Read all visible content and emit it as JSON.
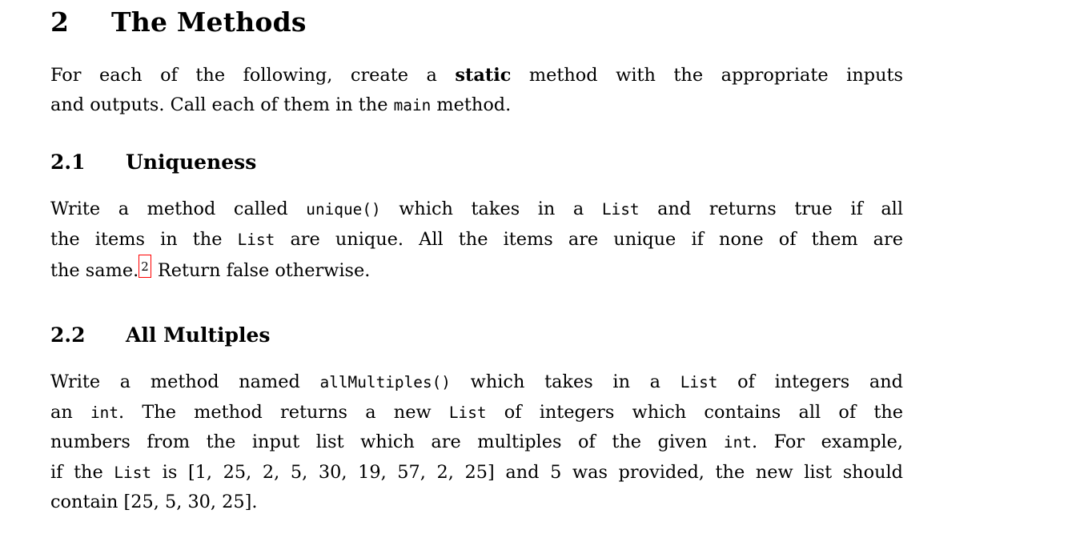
{
  "document": {
    "section": {
      "number": "2",
      "title": "The Methods",
      "intro": {
        "line1_a": "For each of the following, create a ",
        "line1_bold": "static",
        "line1_b": " method with the appropriate inputs",
        "line2_a": "and outputs.  Call each of them in the ",
        "line2_code": "main",
        "line2_b": " method."
      },
      "subsections": [
        {
          "number": "2.1",
          "title": "Uniqueness",
          "body": {
            "line1_a": "Write a method called ",
            "line1_code1": "unique()",
            "line1_b": " which takes in a ",
            "line1_code2": "List",
            "line1_c": " and returns true if all",
            "line2_a": "the items in the ",
            "line2_code": "List",
            "line2_b": " are unique.  All the items are unique if none of them are",
            "line3_a": "the same.",
            "footnote_marker": "2",
            "line3_b": " Return false otherwise."
          }
        },
        {
          "number": "2.2",
          "title": "All Multiples",
          "body": {
            "line1_a": "Write a method named ",
            "line1_code1": "allMultiples()",
            "line1_b": " which takes in a ",
            "line1_code2": "List",
            "line1_c": " of integers and",
            "line2_a": "an ",
            "line2_code": "int",
            "line2_b": ".  The method returns a new ",
            "line2_code2": "List",
            "line2_c": " of integers which contains all of the",
            "line3_a": "numbers from the input list which are multiples of the given ",
            "line3_code": "int",
            "line3_b": ".  For example,",
            "line4_a": "if the ",
            "line4_code": "List",
            "line4_b": " is ",
            "line4_math": "[1, 25, 2, 5, 30, 19, 57, 2, 25]",
            "line4_c": " and 5 was provided, the new list should",
            "line5_a": "contain ",
            "line5_math": "[25, 5, 30, 25]",
            "line5_b": "."
          }
        }
      ]
    }
  },
  "colors": {
    "link_box_border": "#ff0000",
    "text": "#000000",
    "background": "#ffffff"
  }
}
